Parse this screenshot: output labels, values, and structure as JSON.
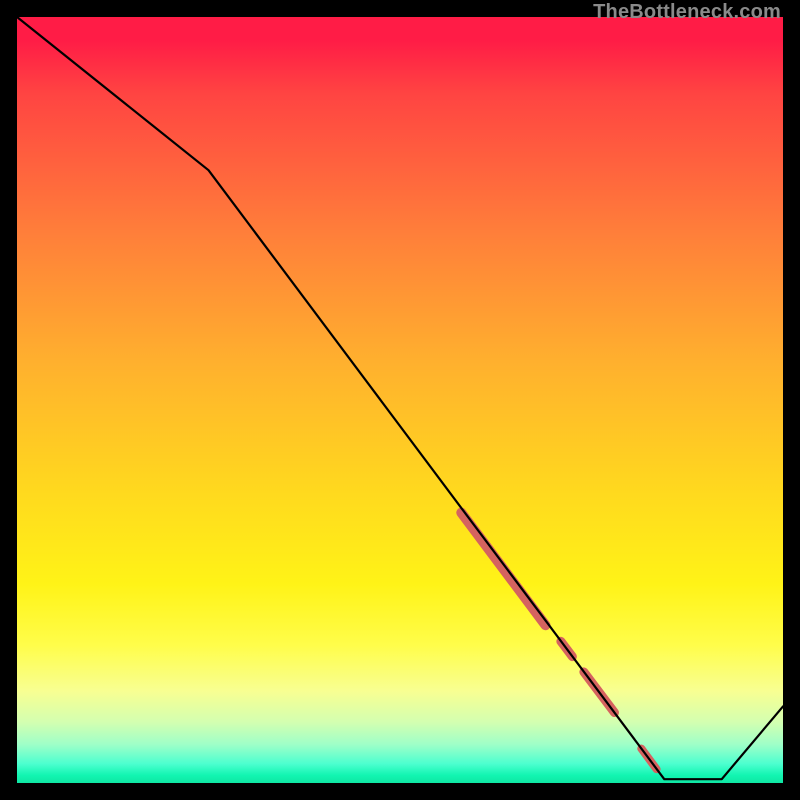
{
  "watermark": "TheBottleneck.com",
  "chart_data": {
    "type": "line",
    "title": "",
    "xlabel": "",
    "ylabel": "",
    "xlim": [
      0,
      100
    ],
    "ylim": [
      0,
      100
    ],
    "grid": false,
    "legend": false,
    "series": [
      {
        "name": "curve",
        "color": "#000000",
        "x": [
          0,
          25,
          84.5,
          92,
          100
        ],
        "y": [
          100,
          80,
          0.5,
          0.5,
          10
        ]
      }
    ],
    "highlight_segments": [
      {
        "x0": 58.0,
        "y0": 35.3,
        "x1": 69.0,
        "y1": 20.6,
        "width": 10
      },
      {
        "x0": 71.0,
        "y0": 18.5,
        "x1": 72.5,
        "y1": 16.5,
        "width": 9
      },
      {
        "x0": 74.0,
        "y0": 14.5,
        "x1": 78.0,
        "y1": 9.2,
        "width": 9
      },
      {
        "x0": 81.5,
        "y0": 4.5,
        "x1": 83.5,
        "y1": 1.8,
        "width": 8
      }
    ],
    "highlight_color": "#d5635f"
  }
}
